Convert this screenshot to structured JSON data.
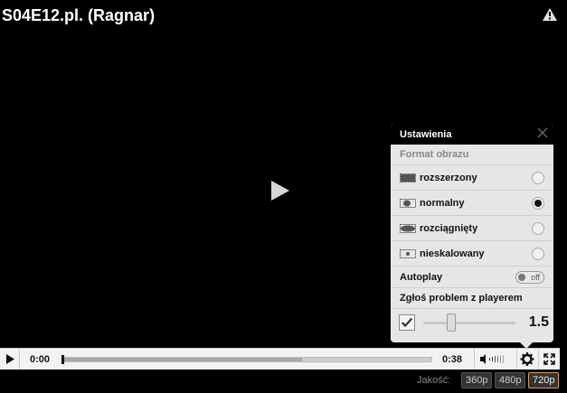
{
  "video": {
    "title": "S04E12.pl. (Ragnar)"
  },
  "settings": {
    "title": "Ustawienia",
    "format_label": "Format obrazu",
    "formats": [
      {
        "label": "rozszerzony",
        "selected": false
      },
      {
        "label": "normalny",
        "selected": true
      },
      {
        "label": "rozciągnięty",
        "selected": false
      },
      {
        "label": "nieskalowany",
        "selected": false
      }
    ],
    "autoplay_label": "Autoplay",
    "autoplay_state": "off",
    "report_label": "Zgłoś problem z playerem",
    "speed_value": "1.5"
  },
  "controls": {
    "current_time": "0:00",
    "duration": "0:38",
    "buffered_fraction": 0.65
  },
  "quality": {
    "label": "Jakość:",
    "options": [
      {
        "label": "360p",
        "active": false
      },
      {
        "label": "480p",
        "active": false
      },
      {
        "label": "720p",
        "active": true
      }
    ]
  },
  "colors": {
    "background": "#000000",
    "panel": "#e6e6e6",
    "active_quality_border": "#d9a05b"
  }
}
